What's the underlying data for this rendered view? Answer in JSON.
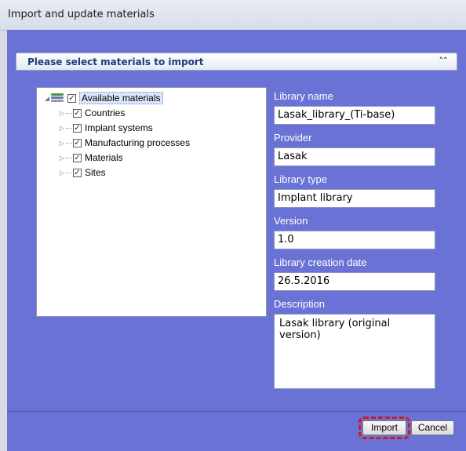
{
  "window": {
    "title": "Import and update materials"
  },
  "panel": {
    "header": "Please select materials to import",
    "collapse_icon": "double-chevron-up-icon"
  },
  "tree": {
    "root": {
      "label": "Available materials",
      "checked": true,
      "expanded": true,
      "icon": "library-stack-icon"
    },
    "children": [
      {
        "label": "Countries",
        "checked": true
      },
      {
        "label": "Implant systems",
        "checked": true
      },
      {
        "label": "Manufacturing processes",
        "checked": true
      },
      {
        "label": "Materials",
        "checked": true
      },
      {
        "label": "Sites",
        "checked": true
      }
    ]
  },
  "form": {
    "library_name": {
      "label": "Library name",
      "value": "Lasak_library_(Ti-base)"
    },
    "provider": {
      "label": "Provider",
      "value": "Lasak"
    },
    "library_type": {
      "label": "Library type",
      "value": "Implant library"
    },
    "version": {
      "label": "Version",
      "value": "1.0"
    },
    "creation_date": {
      "label": "Library creation date",
      "value": "26.5.2016"
    },
    "description": {
      "label": "Description",
      "value": "Lasak library (original version)"
    }
  },
  "buttons": {
    "import": "Import",
    "cancel": "Cancel"
  },
  "colors": {
    "client_bg": "#6a73d5",
    "highlight": "#c81d25",
    "header_text": "#1d3b78"
  }
}
